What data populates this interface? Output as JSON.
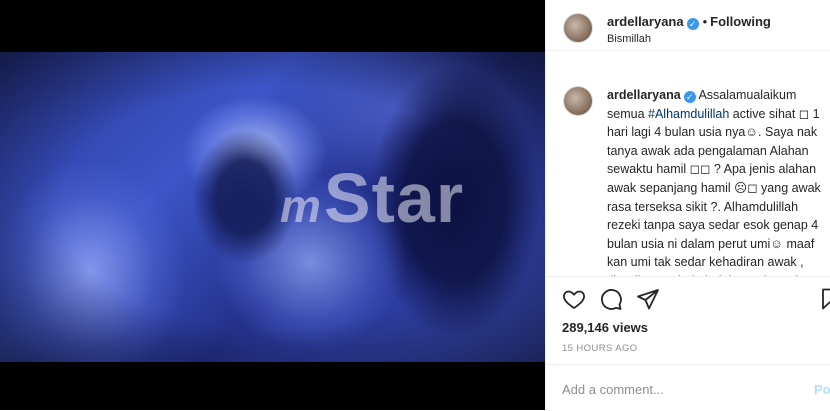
{
  "media": {
    "watermark_prefix": "m",
    "watermark_text": "Star"
  },
  "header": {
    "username": "ardellaryana",
    "separator": "•",
    "follow_status": "Following",
    "subtitle": "Bismillah"
  },
  "caption": {
    "username": "ardellaryana",
    "text_before_tag": "Assalamualaikum semua ",
    "hashtag": "#Alhamdulillah",
    "text_after_tag": " active sihat ◻ 1 hari lagi 4 bulan usia nya☺. Saya nak tanya awak ada pengalaman Alahan sewaktu hamil ◻◻ ? Apa jenis alahan awak sepanjang hamil ☹◻ yang awak rasa terseksa sikit ?. Alhamdulillah rezeki tanpa saya sedar esok genap 4 bulan usia ni dalam perut umi☺ maaf kan umi tak sedar kehadiran awak , tiba-tiba awak da boleh gerak tendang ☺ ♡ Mangulilah"
  },
  "actions": {
    "icons": [
      "heart-icon",
      "comment-icon",
      "share-icon",
      "bookmark-icon"
    ],
    "views": "289,146 views",
    "time": "15 HOURS AGO"
  },
  "comment_box": {
    "placeholder": "Add a comment...",
    "post_label": "Po"
  },
  "colors": {
    "verified": "#3897f0",
    "hashtag": "#003569",
    "post_disabled": "#b2dffc"
  }
}
